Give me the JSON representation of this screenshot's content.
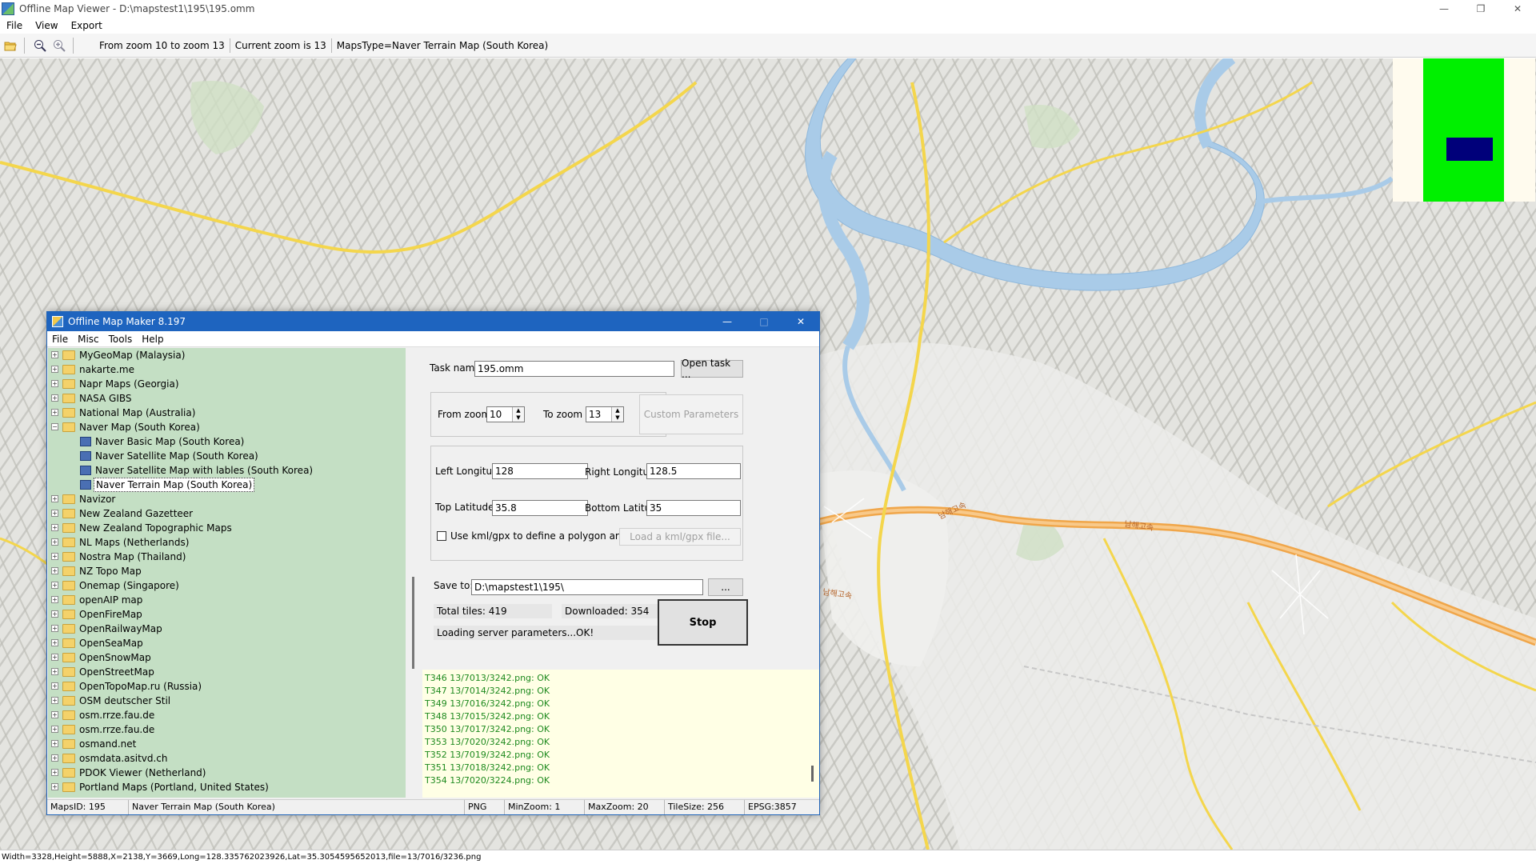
{
  "window": {
    "title": "Offline Map Viewer - D:\\mapstest1\\195\\195.omm",
    "minimize_glyph": "—",
    "maximize_glyph": "❐",
    "close_glyph": "✕"
  },
  "menu": [
    "File",
    "View",
    "Export"
  ],
  "toolbar": {
    "zoom_range": "From zoom 10 to zoom 13",
    "current_zoom": "Current zoom is 13",
    "maps_type": "MapsType=Naver Terrain Map (South Korea)",
    "icons": [
      "open-folder-icon",
      "zoom-out-icon",
      "zoom-in-icon"
    ]
  },
  "map_status": "Width=3328,Height=5888,X=2138,Y=3669,Long=128.335762023926,Lat=35.3054595652013,file=13/7016/3236.png",
  "road_labels": [
    "남해고속",
    "남해고속",
    "남해고속"
  ],
  "colors": {
    "accent": "#1e64bf",
    "tree_bg": "#c4dfc4",
    "log_bg": "#ffffe5",
    "log_text": "#1e8a1e",
    "overview_green": "#00f000",
    "overview_blue": "#00007a",
    "river": "#a9cbe8",
    "road_highway": "#f0a64a",
    "road_yellow": "#f4d64c"
  },
  "dialog": {
    "title": "Offline Map Maker 8.197",
    "menu": [
      "File",
      "Misc",
      "Tools",
      "Help"
    ],
    "tree": [
      {
        "label": "MyGeoMap (Malaysia)",
        "level": 0,
        "expanded": false
      },
      {
        "label": "nakarte.me",
        "level": 0,
        "expanded": false
      },
      {
        "label": "Napr Maps (Georgia)",
        "level": 0,
        "expanded": false
      },
      {
        "label": "NASA GIBS",
        "level": 0,
        "expanded": false
      },
      {
        "label": "National Map (Australia)",
        "level": 0,
        "expanded": false
      },
      {
        "label": "Naver Map (South Korea)",
        "level": 0,
        "expanded": true
      },
      {
        "label": "Naver Basic Map (South Korea)",
        "level": 1
      },
      {
        "label": "Naver Satellite Map (South Korea)",
        "level": 1
      },
      {
        "label": "Naver Satellite Map with lables (South Korea)",
        "level": 1
      },
      {
        "label": "Naver Terrain Map (South Korea)",
        "level": 1,
        "selected": true
      },
      {
        "label": "Navizor",
        "level": 0,
        "expanded": false
      },
      {
        "label": "New Zealand Gazetteer",
        "level": 0,
        "expanded": false
      },
      {
        "label": "New Zealand Topographic Maps",
        "level": 0,
        "expanded": false
      },
      {
        "label": "NL Maps (Netherlands)",
        "level": 0,
        "expanded": false
      },
      {
        "label": "Nostra Map (Thailand)",
        "level": 0,
        "expanded": false
      },
      {
        "label": "NZ Topo Map",
        "level": 0,
        "expanded": false
      },
      {
        "label": "Onemap (Singapore)",
        "level": 0,
        "expanded": false
      },
      {
        "label": "openAIP map",
        "level": 0,
        "expanded": false
      },
      {
        "label": "OpenFireMap",
        "level": 0,
        "expanded": false
      },
      {
        "label": "OpenRailwayMap",
        "level": 0,
        "expanded": false
      },
      {
        "label": "OpenSeaMap",
        "level": 0,
        "expanded": false
      },
      {
        "label": "OpenSnowMap",
        "level": 0,
        "expanded": false
      },
      {
        "label": "OpenStreetMap",
        "level": 0,
        "expanded": false
      },
      {
        "label": "OpenTopoMap.ru (Russia)",
        "level": 0,
        "expanded": false
      },
      {
        "label": "OSM deutscher Stil",
        "level": 0,
        "expanded": false
      },
      {
        "label": "osm.rrze.fau.de",
        "level": 0,
        "expanded": false
      },
      {
        "label": "osm.rrze.fau.de",
        "level": 0,
        "expanded": false
      },
      {
        "label": "osmand.net",
        "level": 0,
        "expanded": false
      },
      {
        "label": "osmdata.asitvd.ch",
        "level": 0,
        "expanded": false
      },
      {
        "label": "PDOK Viewer (Netherland)",
        "level": 0,
        "expanded": false
      },
      {
        "label": "Portland Maps (Portland, United States)",
        "level": 0,
        "expanded": false
      }
    ],
    "task": {
      "task_name_label": "Task name",
      "task_name_value": "195.omm",
      "open_task_label": "Open task ...",
      "from_zoom_label": "From zoom",
      "from_zoom_value": "10",
      "to_zoom_label": "To zoom",
      "to_zoom_value": "13",
      "custom_params_label": "Custom Parameters",
      "left_lon_label": "Left Longitude",
      "left_lon_value": "128",
      "right_lon_label": "Right Longitude",
      "right_lon_value": "128.5",
      "top_lat_label": "Top Latitude",
      "top_lat_value": "35.8",
      "bottom_lat_label": "Bottom Latitude",
      "bottom_lat_value": "35",
      "kml_checkbox_label": "Use kml/gpx to define a polygon area",
      "load_kml_label": "Load a kml/gpx file...",
      "save_to_label": "Save to:",
      "save_to_value": "D:\\mapstest1\\195\\",
      "browse_label": "...",
      "total_tiles": "Total tiles: 419",
      "downloaded": "Downloaded: 354",
      "status": "Loading server parameters...OK!",
      "stop_label": "Stop"
    },
    "log": [
      "T346 13/7013/3242.png: OK",
      "T347 13/7014/3242.png: OK",
      "T349 13/7016/3242.png: OK",
      "T348 13/7015/3242.png: OK",
      "T350 13/7017/3242.png: OK",
      "T353 13/7020/3242.png: OK",
      "T352 13/7019/3242.png: OK",
      "T351 13/7018/3242.png: OK",
      "T354 13/7020/3224.png: OK"
    ],
    "status_bar": {
      "maps_id": "MapsID: 195",
      "map_name": "Naver Terrain Map (South Korea)",
      "format": "PNG",
      "min_zoom": "MinZoom: 1",
      "max_zoom": "MaxZoom: 20",
      "tile_size": "TileSize: 256",
      "epsg": "EPSG:3857"
    }
  }
}
